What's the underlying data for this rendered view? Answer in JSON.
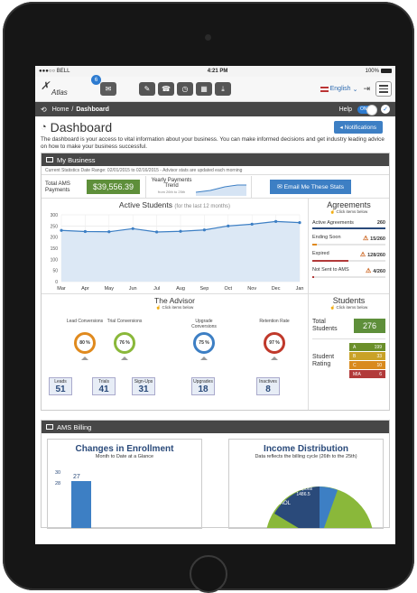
{
  "status_bar": {
    "carrier": "●●●○○ BELL",
    "time": "4:21 PM",
    "battery": "100%"
  },
  "header": {
    "logo_text": "Atlas",
    "message_badge": "6",
    "language": "English",
    "tool_icons": [
      "edit-icon",
      "phone-icon",
      "clock-icon",
      "calendar-icon",
      "download-icon"
    ]
  },
  "nav": {
    "breadcrumb_home": "Home",
    "breadcrumb_sep": "/",
    "breadcrumb_current": "Dashboard",
    "help": "Help",
    "toggle_label": "ON"
  },
  "dashboard": {
    "title": "Dashboard",
    "description": "The dashboard is your access to vital information about your business. You can make informed decisions and get industry leading advice on how to make your business successful.",
    "notifications_button": "Notifications"
  },
  "my_business": {
    "title": "My Business",
    "date_range": "Current Statistics Date Range: 02/01/2015 to 02/16/2015 - Advisor stats are updated each morning",
    "total_label": "Total AMS Payments",
    "total_value": "$39,556.39",
    "trend_label": "Yearly Payments Trend",
    "trend_sub": "from 26th to 25th",
    "email_button": "Email Me These Stats"
  },
  "chart_data": {
    "type": "area",
    "title": "Active Students",
    "subtitle": "(for the last 12 months)",
    "categories": [
      "Mar",
      "Apr",
      "May",
      "Jun",
      "Jul",
      "Aug",
      "Sep",
      "Oct",
      "Nov",
      "Dec",
      "Jan"
    ],
    "values": [
      230,
      225,
      224,
      238,
      223,
      226,
      232,
      250,
      258,
      270,
      265
    ],
    "ylim": [
      0,
      300
    ],
    "yticks": [
      0,
      50,
      100,
      150,
      200,
      250,
      300
    ],
    "grid": true
  },
  "agreements": {
    "title": "Agreements",
    "hint": "Click items below",
    "items": [
      {
        "label": "Active Agreements",
        "value": "260",
        "warn": false,
        "color": "#2a4a7a",
        "fraction": 1.0
      },
      {
        "label": "Ending Soon",
        "value": "15/260",
        "warn": true,
        "color": "#e08a1e",
        "fraction": 0.06
      },
      {
        "label": "Expired",
        "value": "128/260",
        "warn": true,
        "color": "#b23a3a",
        "fraction": 0.49
      },
      {
        "label": "Not Sent to AMS",
        "value": "4/260",
        "warn": true,
        "color": "#b23a3a",
        "fraction": 0.02
      }
    ]
  },
  "advisor": {
    "title": "The Advisor",
    "hint": "Click items below",
    "gauges": [
      {
        "label": "Lead Conversions",
        "value": "80 %",
        "color": "#e08a1e"
      },
      {
        "label": "Trial Conversions",
        "value": "76 %",
        "color": "#8ab83a"
      },
      {
        "label": "Upgrade Conversions",
        "value": "75 %",
        "color": "#3d7fc4"
      },
      {
        "label": "Retention Rate",
        "value": "97 %",
        "color": "#c0392b"
      }
    ],
    "counts": [
      {
        "label": "Leads",
        "value": "51"
      },
      {
        "label": "Trials",
        "value": "41"
      },
      {
        "label": "Sign-Ups",
        "value": "31"
      },
      {
        "label": "Upgrades",
        "value": "18"
      },
      {
        "label": "Inactives",
        "value": "8"
      }
    ]
  },
  "students": {
    "title": "Students",
    "hint": "Click items below",
    "total_label": "Total Students",
    "total_value": "276",
    "rating_label": "Student Rating",
    "ratings": [
      {
        "grade": "A",
        "count": "199",
        "color": "#6b8f2a"
      },
      {
        "grade": "B",
        "count": "33",
        "color": "#c9a227"
      },
      {
        "grade": "C",
        "count": "10",
        "color": "#d98a1e"
      },
      {
        "grade": "MIA",
        "count": "6",
        "color": "#b23a3a"
      }
    ]
  },
  "billing": {
    "title": "AMS Billing",
    "enrollment_title": "Changes in Enrollment",
    "enrollment_sub": "Month to Date at a Glance",
    "enrollment_y1": "30",
    "enrollment_y2": "28",
    "enrollment_val": "27",
    "income_title": "Income Distribution",
    "income_sub": "Data reflects the billing cycle (26th to the 25th)",
    "coupons_label": "Coupons",
    "coupons_value": "1486.5",
    "aol_label": "AOL"
  }
}
